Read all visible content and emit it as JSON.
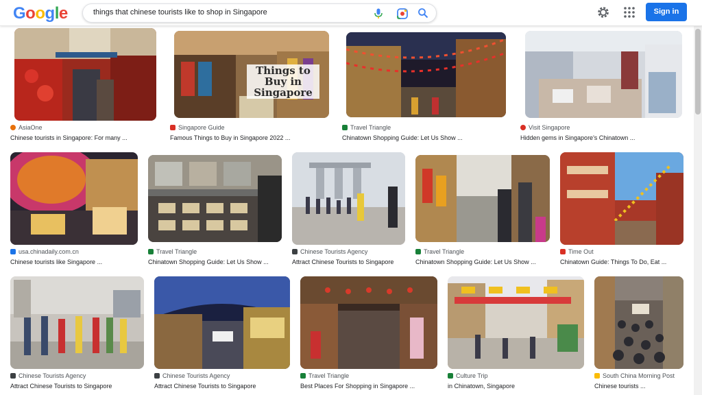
{
  "header": {
    "logo_letters": [
      "G",
      "o",
      "o",
      "g",
      "l",
      "e"
    ],
    "logo_colors": [
      "#4285f4",
      "#ea4335",
      "#fbbc05",
      "#4285f4",
      "#34a853",
      "#ea4335"
    ],
    "search_value": "things that chinese tourists like to shop in Singapore",
    "sign_in_label": "Sign in",
    "accent": "#1a73e8"
  },
  "results": [
    {
      "source": "AsiaOne",
      "title": "Chinese tourists in Singapore: For many ...",
      "favicon_color": "#e8710a"
    },
    {
      "source": "Singapore Guide",
      "title": "Famous Things to Buy in Singapore 2022 ...",
      "favicon_color": "#d93025",
      "overlay": "Things to Buy in Singapore"
    },
    {
      "source": "Travel Triangle",
      "title": "Chinatown Shopping Guide: Let Us Show ...",
      "favicon_color": "#188038"
    },
    {
      "source": "Visit Singapore",
      "title": "Hidden gems in Singapore's Chinatown ...",
      "favicon_color": "#d93025"
    },
    {
      "source": "usa.chinadaily.com.cn",
      "title": "Chinese tourists like Singapore ...",
      "favicon_color": "#1a73e8"
    },
    {
      "source": "Travel Triangle",
      "title": "Chinatown Shopping Guide: Let Us Show ...",
      "favicon_color": "#188038"
    },
    {
      "source": "Chinese Tourists Agency",
      "title": "Attract Chinese Tourists to Singapore",
      "favicon_color": "#3c4043"
    },
    {
      "source": "Travel Triangle",
      "title": "Chinatown Shopping Guide: Let Us Show ...",
      "favicon_color": "#188038"
    },
    {
      "source": "Time Out",
      "title": "Chinatown Guide: Things To Do, Eat ...",
      "favicon_color": "#d93025"
    },
    {
      "source": "Chinese Tourists Agency",
      "title": "Attract Chinese Tourists to Singapore",
      "favicon_color": "#3c4043"
    },
    {
      "source": "Chinese Tourists Agency",
      "title": "Attract Chinese Tourists to Singapore",
      "favicon_color": "#3c4043"
    },
    {
      "source": "Travel Triangle",
      "title": "Best Places For Shopping in Singapore ...",
      "favicon_color": "#188038"
    },
    {
      "source": "Culture Trip",
      "title": "in Chinatown, Singapore",
      "favicon_color": "#188038"
    },
    {
      "source": "South China Morning Post",
      "title": "Chinese tourists ...",
      "favicon_color": "#fbbc05"
    }
  ]
}
